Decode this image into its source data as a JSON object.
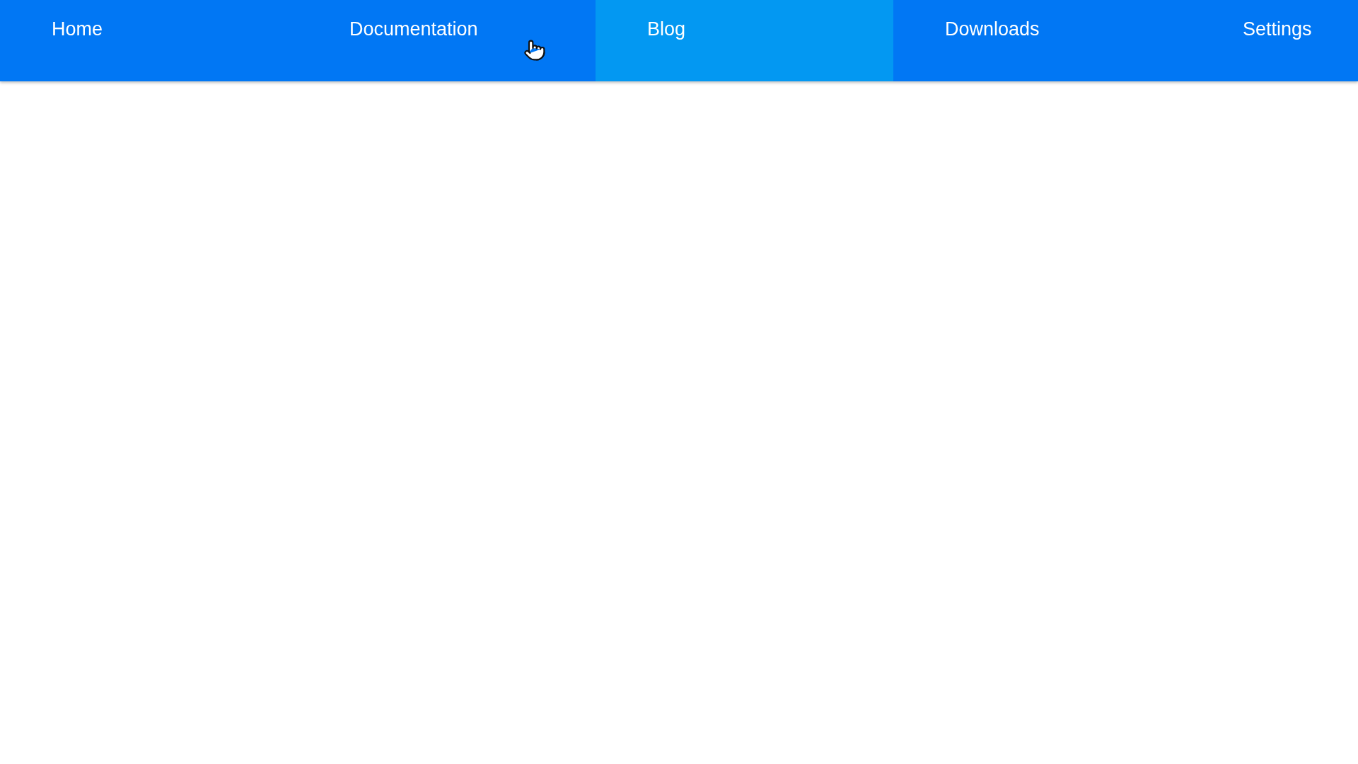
{
  "nav": {
    "items": [
      {
        "label": "Home",
        "selected": false
      },
      {
        "label": "Documentation",
        "selected": false
      },
      {
        "label": "Blog",
        "selected": true
      },
      {
        "label": "Downloads",
        "selected": false
      },
      {
        "label": "Settings",
        "selected": false
      }
    ]
  }
}
